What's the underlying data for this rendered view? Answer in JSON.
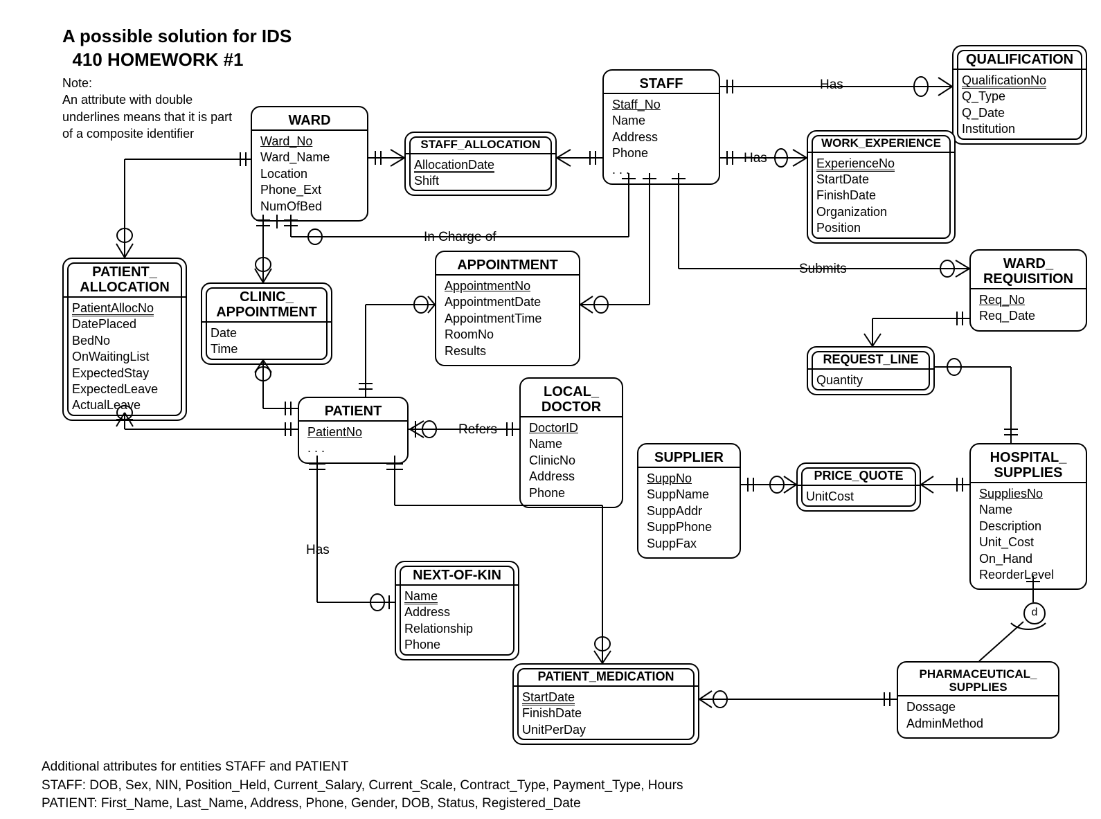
{
  "heading": {
    "line1": "A possible solution for IDS",
    "line2": "410 HOMEWORK #1"
  },
  "note": {
    "line1": "Note:",
    "line2": "An attribute with double",
    "line3": "underlines  means that it is part",
    "line4": "of a composite identifier"
  },
  "entities": {
    "ward": {
      "title": "WARD",
      "attrs": [
        "Ward_No",
        "Ward_Name",
        "Location",
        "Phone_Ext",
        "NumOfBed"
      ],
      "pk": [
        0
      ]
    },
    "staff": {
      "title": "STAFF",
      "attrs": [
        "Staff_No",
        "Name",
        "Address",
        "Phone",
        ". . ."
      ],
      "pk": [
        0
      ]
    },
    "qualification": {
      "title": "QUALIFICATION",
      "attrs": [
        "QualificationNo",
        "Q_Type",
        "Q_Date",
        "Institution"
      ],
      "comp": [
        0
      ]
    },
    "work_experience": {
      "title": "WORK_EXPERIENCE",
      "attrs": [
        "ExperienceNo",
        "StartDate",
        "FinishDate",
        "Organization",
        "Position"
      ],
      "comp": [
        0
      ]
    },
    "staff_allocation": {
      "title": "STAFF_ALLOCATION",
      "attrs": [
        "AllocationDate",
        "Shift"
      ],
      "comp": [
        0
      ]
    },
    "patient_allocation": {
      "title": "PATIENT_\nALLOCATION",
      "attrs": [
        "PatientAllocNo",
        "DatePlaced",
        "BedNo",
        "OnWaitingList",
        "ExpectedStay",
        "ExpectedLeave",
        "ActualLeave"
      ],
      "comp": [
        0
      ]
    },
    "clinic_appointment": {
      "title": "CLINIC_\nAPPOINTMENT",
      "attrs": [
        "Date",
        "Time"
      ]
    },
    "appointment": {
      "title": "APPOINTMENT",
      "attrs": [
        "AppointmentNo",
        "AppointmentDate",
        "AppointmentTime",
        "RoomNo",
        "Results"
      ],
      "pk": [
        0
      ]
    },
    "ward_requisition": {
      "title": "WARD_\nREQUISITION",
      "attrs": [
        "Req_No",
        "Req_Date"
      ],
      "pk": [
        0
      ]
    },
    "request_line": {
      "title": "REQUEST_LINE",
      "attrs": [
        "Quantity"
      ]
    },
    "patient": {
      "title": "PATIENT",
      "attrs": [
        "PatientNo",
        ". . ."
      ],
      "pk": [
        0
      ]
    },
    "local_doctor": {
      "title": "LOCAL_\nDOCTOR",
      "attrs": [
        "DoctorID",
        "Name",
        "ClinicNo",
        "Address",
        "Phone"
      ],
      "pk": [
        0
      ]
    },
    "supplier": {
      "title": "SUPPLIER",
      "attrs": [
        "SuppNo",
        "SuppName",
        "SuppAddr",
        "SuppPhone",
        "SuppFax"
      ],
      "pk": [
        0
      ]
    },
    "price_quote": {
      "title": "PRICE_QUOTE",
      "attrs": [
        "UnitCost"
      ]
    },
    "hospital_supplies": {
      "title": "HOSPITAL_\nSUPPLIES",
      "attrs": [
        "SuppliesNo",
        "Name",
        "Description",
        "Unit_Cost",
        "On_Hand",
        "ReorderLevel"
      ],
      "pk": [
        0
      ]
    },
    "next_of_kin": {
      "title": "NEXT-OF-KIN",
      "attrs": [
        "Name",
        "Address",
        "Relationship",
        "Phone"
      ],
      "comp": [
        0
      ]
    },
    "patient_medication": {
      "title": "PATIENT_MEDICATION",
      "attrs": [
        "StartDate",
        "FinishDate",
        "UnitPerDay"
      ],
      "comp": [
        0
      ]
    },
    "pharmaceutical_supplies": {
      "title": "PHARMACEUTICAL_\nSUPPLIES",
      "attrs": [
        "Dossage",
        "AdminMethod"
      ]
    }
  },
  "relationship_labels": {
    "has_qual": "Has",
    "has_exp": "Has",
    "submits": "Submits",
    "in_charge_of": "In Charge of",
    "refers": "Refers",
    "has_kin": "Has",
    "d_symbol": "d"
  },
  "footer": {
    "line1": "Additional attributes for entities STAFF and PATIENT",
    "line2": "STAFF: DOB, Sex, NIN, Position_Held, Current_Salary, Current_Scale, Contract_Type, Payment_Type, Hours",
    "line3": "PATIENT: First_Name, Last_Name, Address, Phone, Gender, DOB, Status, Registered_Date"
  }
}
